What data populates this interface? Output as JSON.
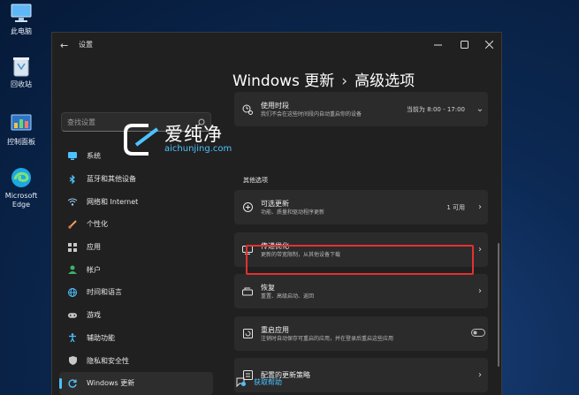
{
  "desktop": {
    "icons": [
      {
        "label": "此电脑",
        "icon": "computer-icon"
      },
      {
        "label": "回收站",
        "icon": "recycle-bin-icon"
      },
      {
        "label": "控制面板",
        "icon": "control-panel-icon"
      },
      {
        "label": "Microsoft Edge",
        "icon": "edge-icon"
      }
    ]
  },
  "window": {
    "title": "设置",
    "controls": [
      "minimize",
      "maximize",
      "close"
    ]
  },
  "sidebar": {
    "search_placeholder": "查找设置",
    "items": [
      {
        "label": "系统",
        "icon": "system-icon",
        "color": "#4cc2ff"
      },
      {
        "label": "蓝牙和其他设备",
        "icon": "bluetooth-icon",
        "color": "#4cc2ff"
      },
      {
        "label": "网络和 Internet",
        "icon": "network-icon",
        "color": "#9ad3ff"
      },
      {
        "label": "个性化",
        "icon": "brush-icon",
        "color": "#f0a060"
      },
      {
        "label": "应用",
        "icon": "apps-icon",
        "color": "#c8c8c8"
      },
      {
        "label": "帐户",
        "icon": "account-icon",
        "color": "#3fb36b"
      },
      {
        "label": "时间和语言",
        "icon": "globe-icon",
        "color": "#4cc2ff"
      },
      {
        "label": "游戏",
        "icon": "gamepad-icon",
        "color": "#c8c8c8"
      },
      {
        "label": "辅助功能",
        "icon": "accessibility-icon",
        "color": "#4cc2ff"
      },
      {
        "label": "隐私和安全性",
        "icon": "shield-icon",
        "color": "#c8c8c8"
      },
      {
        "label": "Windows 更新",
        "icon": "update-icon",
        "color": "#4cc2ff",
        "active": true
      }
    ]
  },
  "main": {
    "breadcrumb_parent": "Windows 更新",
    "breadcrumb_separator": "›",
    "breadcrumb_current": "高级选项",
    "active_hours": {
      "title": "使用时段",
      "subtitle": "我们不会在这些时间段内自动重启你的设备",
      "value": "当前为 8:00 - 17:00"
    },
    "section_title": "其他选项",
    "cards": [
      {
        "title": "可选更新",
        "subtitle": "功能、质量和驱动程序更新",
        "value": "1 可用",
        "icon": "plus-circle-icon"
      },
      {
        "title": "传递优化",
        "subtitle": "更新的带宽限制，从其他设备下载",
        "value": "",
        "icon": "delivery-icon"
      },
      {
        "title": "恢复",
        "subtitle": "重置、高级启动、返回",
        "value": "",
        "icon": "recovery-icon"
      },
      {
        "title": "重启应用",
        "subtitle": "注销时自动保存可重启的应用，并在登录后重启这些应用",
        "value": "",
        "icon": "restart-apps-icon",
        "toggle": "off"
      },
      {
        "title": "配置的更新策略",
        "subtitle": "",
        "value": "",
        "icon": "policy-icon"
      }
    ],
    "help_link": "获取帮助"
  },
  "watermark": {
    "name": "爱纯净",
    "url": "aichunjing.com"
  },
  "highlight_color": "#e53030",
  "accent_color": "#4cc2ff"
}
